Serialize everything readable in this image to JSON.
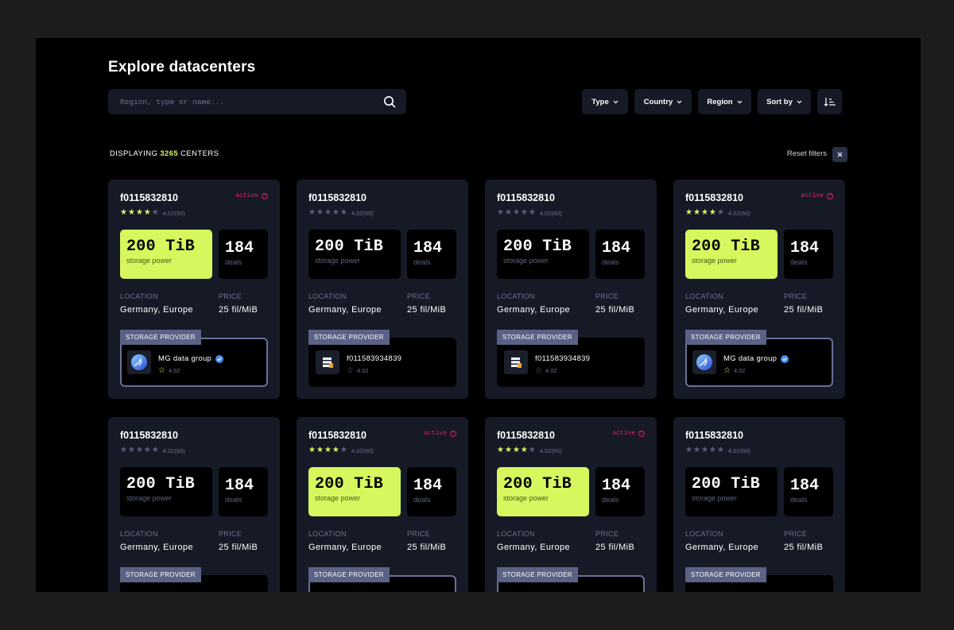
{
  "header": {
    "title": "Explore datacenters",
    "search_placeholder": "Region, type or name..."
  },
  "filters": {
    "type": "Type",
    "country": "Country",
    "region": "Region",
    "sort_by": "Sort by"
  },
  "summary": {
    "prefix": "DISPLAYING",
    "count": "3265",
    "suffix": "CENTERS",
    "reset_label": "Reset filters"
  },
  "colors": {
    "accent": "#d6f75d",
    "active": "#d8226a",
    "card": "#151a26",
    "tag": "#5a6285"
  },
  "cards": [
    {
      "id": "f0115832810",
      "active": true,
      "status": "active",
      "stars": 4,
      "rating": "4.02",
      "reviews": "(60)",
      "highlight": true,
      "storage": "200 TiB",
      "storage_label": "storage power",
      "deals": "184",
      "deals_label": "deals",
      "location_label": "LOCATION",
      "location": "Germany, Europe",
      "price_label": "PRICE",
      "price": "25 fil/MiB",
      "provider_label": "STORAGE PROVIDER",
      "provider": {
        "name": "MG data group",
        "rating": "4.02",
        "verified": true,
        "icon": "globe-icon",
        "star_on": true
      }
    },
    {
      "id": "f0115832810",
      "active": false,
      "status": "",
      "stars": 0,
      "rating": "4.02",
      "reviews": "(60)",
      "highlight": false,
      "storage": "200 TiB",
      "storage_label": "storage power",
      "deals": "184",
      "deals_label": "deals",
      "location_label": "LOCATION",
      "location": "Germany, Europe",
      "price_label": "PRICE",
      "price": "25 fil/MiB",
      "provider_label": "STORAGE PROVIDER",
      "provider": {
        "name": "f011583934839",
        "rating": "4.02",
        "verified": false,
        "icon": "server-icon",
        "star_on": false
      }
    },
    {
      "id": "f0115832810",
      "active": false,
      "status": "",
      "stars": 0,
      "rating": "4.02",
      "reviews": "(60)",
      "highlight": false,
      "storage": "200 TiB",
      "storage_label": "storage power",
      "deals": "184",
      "deals_label": "deals",
      "location_label": "LOCATION",
      "location": "Germany, Europe",
      "price_label": "PRICE",
      "price": "25 fil/MiB",
      "provider_label": "STORAGE PROVIDER",
      "provider": {
        "name": "f011583934839",
        "rating": "4.02",
        "verified": false,
        "icon": "server-icon",
        "star_on": false
      }
    },
    {
      "id": "f0115832810",
      "active": true,
      "status": "active",
      "stars": 4,
      "rating": "4.02",
      "reviews": "(60)",
      "highlight": true,
      "storage": "200 TiB",
      "storage_label": "storage power",
      "deals": "184",
      "deals_label": "deals",
      "location_label": "LOCATION",
      "location": "Germany, Europe",
      "price_label": "PRICE",
      "price": "25 fil/MiB",
      "provider_label": "STORAGE PROVIDER",
      "provider": {
        "name": "MG data group",
        "rating": "4.02",
        "verified": true,
        "icon": "globe-icon",
        "star_on": true
      }
    },
    {
      "id": "f0115832810",
      "active": false,
      "status": "",
      "stars": 0,
      "rating": "4.02",
      "reviews": "(60)",
      "highlight": false,
      "storage": "200 TiB",
      "storage_label": "storage power",
      "deals": "184",
      "deals_label": "deals",
      "location_label": "LOCATION",
      "location": "Germany, Europe",
      "price_label": "PRICE",
      "price": "25 fil/MiB",
      "provider_label": "STORAGE PROVIDER",
      "provider": null
    },
    {
      "id": "f0115832810",
      "active": true,
      "status": "active",
      "stars": 4,
      "rating": "4.02",
      "reviews": "(60)",
      "highlight": true,
      "storage": "200 TiB",
      "storage_label": "storage power",
      "deals": "184",
      "deals_label": "deals",
      "location_label": "LOCATION",
      "location": "Germany, Europe",
      "price_label": "PRICE",
      "price": "25 fil/MiB",
      "provider_label": "STORAGE PROVIDER",
      "provider": null
    },
    {
      "id": "f0115832810",
      "active": true,
      "status": "active",
      "stars": 4,
      "rating": "4.02",
      "reviews": "(60)",
      "highlight": true,
      "storage": "200 TiB",
      "storage_label": "storage power",
      "deals": "184",
      "deals_label": "deals",
      "location_label": "LOCATION",
      "location": "Germany, Europe",
      "price_label": "PRICE",
      "price": "25 fil/MiB",
      "provider_label": "STORAGE PROVIDER",
      "provider": null
    },
    {
      "id": "f0115832810",
      "active": false,
      "status": "",
      "stars": 0,
      "rating": "4.02",
      "reviews": "(60)",
      "highlight": false,
      "storage": "200 TiB",
      "storage_label": "storage power",
      "deals": "184",
      "deals_label": "deals",
      "location_label": "LOCATION",
      "location": "Germany, Europe",
      "price_label": "PRICE",
      "price": "25 fil/MiB",
      "provider_label": "STORAGE PROVIDER",
      "provider": null
    }
  ]
}
